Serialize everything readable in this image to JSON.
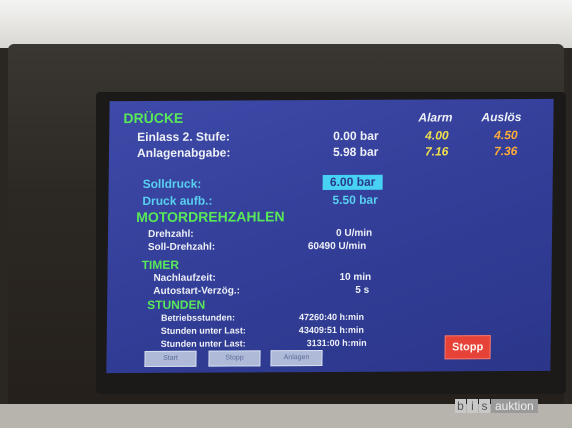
{
  "druecke": {
    "title": "DRÜCKE",
    "alarm_header": "Alarm",
    "ausloes_header": "Auslös",
    "einlass_label": "Einlass 2. Stufe:",
    "einlass_value": "0.00 bar",
    "einlass_alarm": "4.00",
    "einlass_ausloes": "4.50",
    "anlagen_label": "Anlagenabgabe:",
    "anlagen_value": "5.98 bar",
    "anlagen_alarm": "7.16",
    "anlagen_ausloes": "7.36",
    "solldruck_label": "Solldruck:",
    "solldruck_value": "6.00 bar",
    "druckaufb_label": "Druck aufb.:",
    "druckaufb_value": "5.50 bar"
  },
  "motor": {
    "title": "MOTORDREHZAHLEN",
    "drehzahl_label": "Drehzahl:",
    "drehzahl_value": "0 U/min",
    "soll_label": "Soll-Drehzahl:",
    "soll_value": "60490 U/min"
  },
  "timer": {
    "title": "TIMER",
    "nachlauf_label": "Nachlaufzeit:",
    "nachlauf_value": "10 min",
    "autostart_label": "Autostart-Verzög.:",
    "autostart_value": "5 s"
  },
  "stunden": {
    "title": "STUNDEN",
    "betrieb_label": "Betriebsstunden:",
    "betrieb_value": "47260:40 h:min",
    "last1_label": "Stunden unter Last:",
    "last1_value": "43409:51 h:min",
    "last2_label": "Stunden unter Last:",
    "last2_value": "3131:00 h:min"
  },
  "buttons": {
    "stopp": "Stopp",
    "soft1": "Start",
    "soft2": "Stopp",
    "soft3": "Anlagen"
  },
  "watermark": {
    "letters": [
      "b",
      "i",
      "s"
    ],
    "word": "auktion"
  },
  "colors": {
    "screen_bg": "#3440a0",
    "heading_green": "#58e858",
    "cyan": "#58d0f0",
    "alarm_yellow": "#f2e04a",
    "ausloes_orange": "#ffab38",
    "stop_red": "#e64238"
  }
}
